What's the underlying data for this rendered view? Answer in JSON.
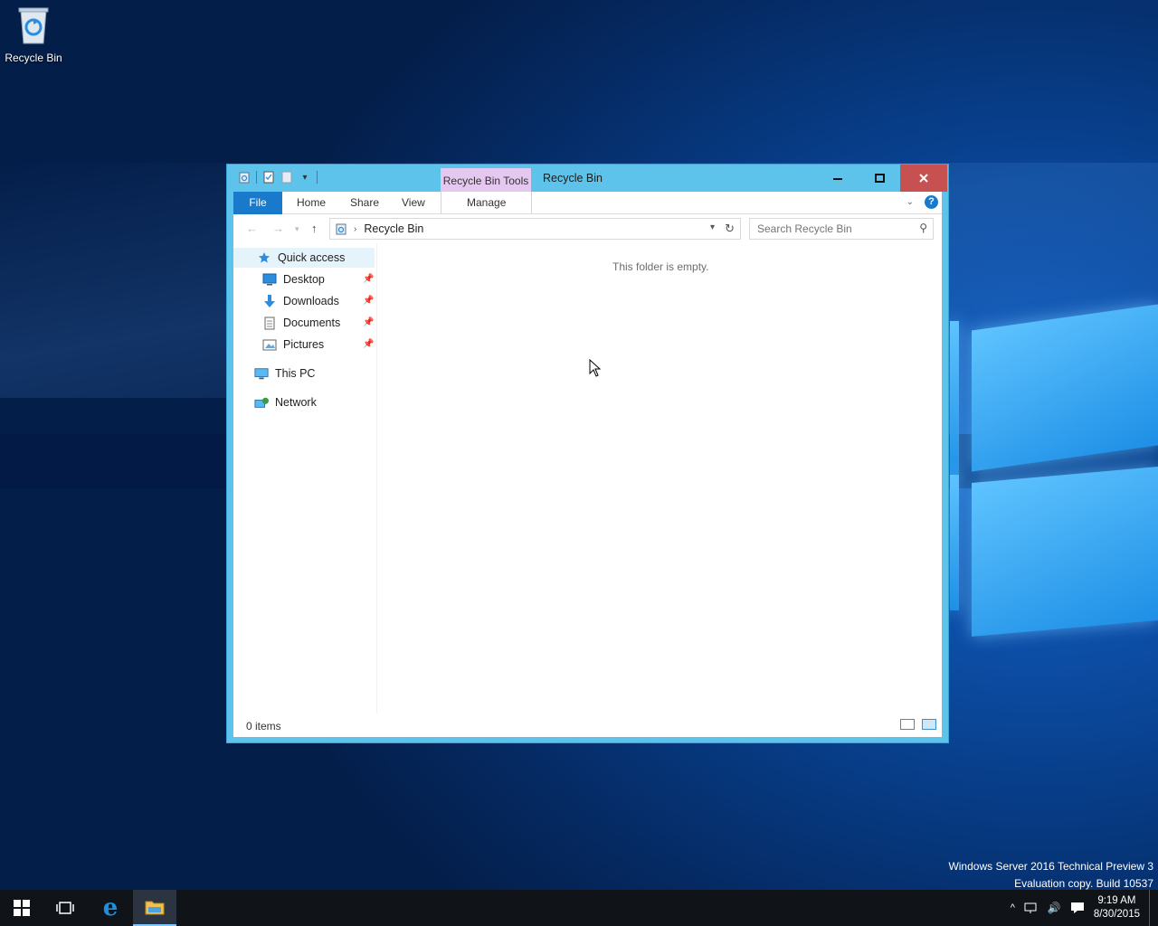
{
  "desktop": {
    "icon_label": "Recycle Bin",
    "watermark_line1": "Windows Server 2016 Technical Preview 3",
    "watermark_line2": "Evaluation copy. Build 10537"
  },
  "window": {
    "title": "Recycle Bin",
    "context_tab": "Recycle Bin Tools",
    "ribbon_tabs": [
      "File",
      "Home",
      "Share",
      "View",
      "Manage"
    ],
    "address_path": "Recycle Bin",
    "search_placeholder": "Search Recycle Bin",
    "empty_message": "This folder is empty.",
    "status": "0 items"
  },
  "nav": {
    "quick_access": "Quick access",
    "pinned": [
      {
        "label": "Desktop",
        "icon": "desktop-icon"
      },
      {
        "label": "Downloads",
        "icon": "downloads-icon"
      },
      {
        "label": "Documents",
        "icon": "documents-icon"
      },
      {
        "label": "Pictures",
        "icon": "pictures-icon"
      }
    ],
    "this_pc": "This PC",
    "network": "Network"
  },
  "taskbar": {
    "time": "9:19 AM",
    "date": "8/30/2015"
  },
  "colors": {
    "accent": "#1979ca",
    "titlebar": "#5ec3ea",
    "close": "#c75050",
    "context_tab": "#e5c8f0"
  }
}
